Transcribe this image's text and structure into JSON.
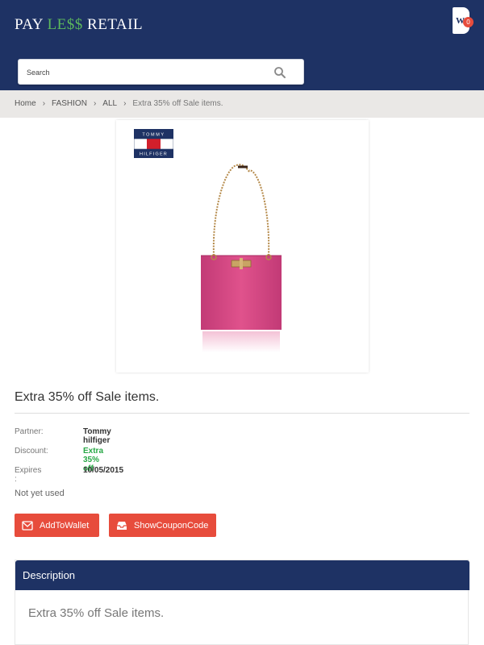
{
  "header": {
    "brand_part1": "PAY ",
    "brand_accent": "LE$$",
    "brand_part2": " RETAIL",
    "wallet_letter": "W",
    "wallet_count": "0",
    "colors": {
      "background": "#1e3264",
      "accent": "#5cb85c",
      "badge": "#e74c3c"
    }
  },
  "search": {
    "placeholder": "Search",
    "value": "",
    "icon": "search-icon"
  },
  "breadcrumb": {
    "items": [
      "Home",
      "FASHION",
      "ALL"
    ],
    "current": "Extra 35% off Sale items."
  },
  "product": {
    "brand_logo_top": "TOMMY",
    "brand_logo_bottom": "HILFIGER",
    "title": "Extra 35% off Sale items.",
    "details": {
      "partner_label": "Partner:",
      "partner_value": "Tommy hilfiger",
      "discount_label": "Discount:",
      "discount_value": "Extra 35% off",
      "expires_label": "Expires :",
      "expires_value": "10/05/2015"
    },
    "status": "Not yet used"
  },
  "actions": {
    "add_to_wallet": "AddToWallet",
    "show_coupon": "ShowCouponCode",
    "color": "#e74c3c"
  },
  "description": {
    "heading": "Description",
    "text": "Extra 35% off Sale items."
  }
}
